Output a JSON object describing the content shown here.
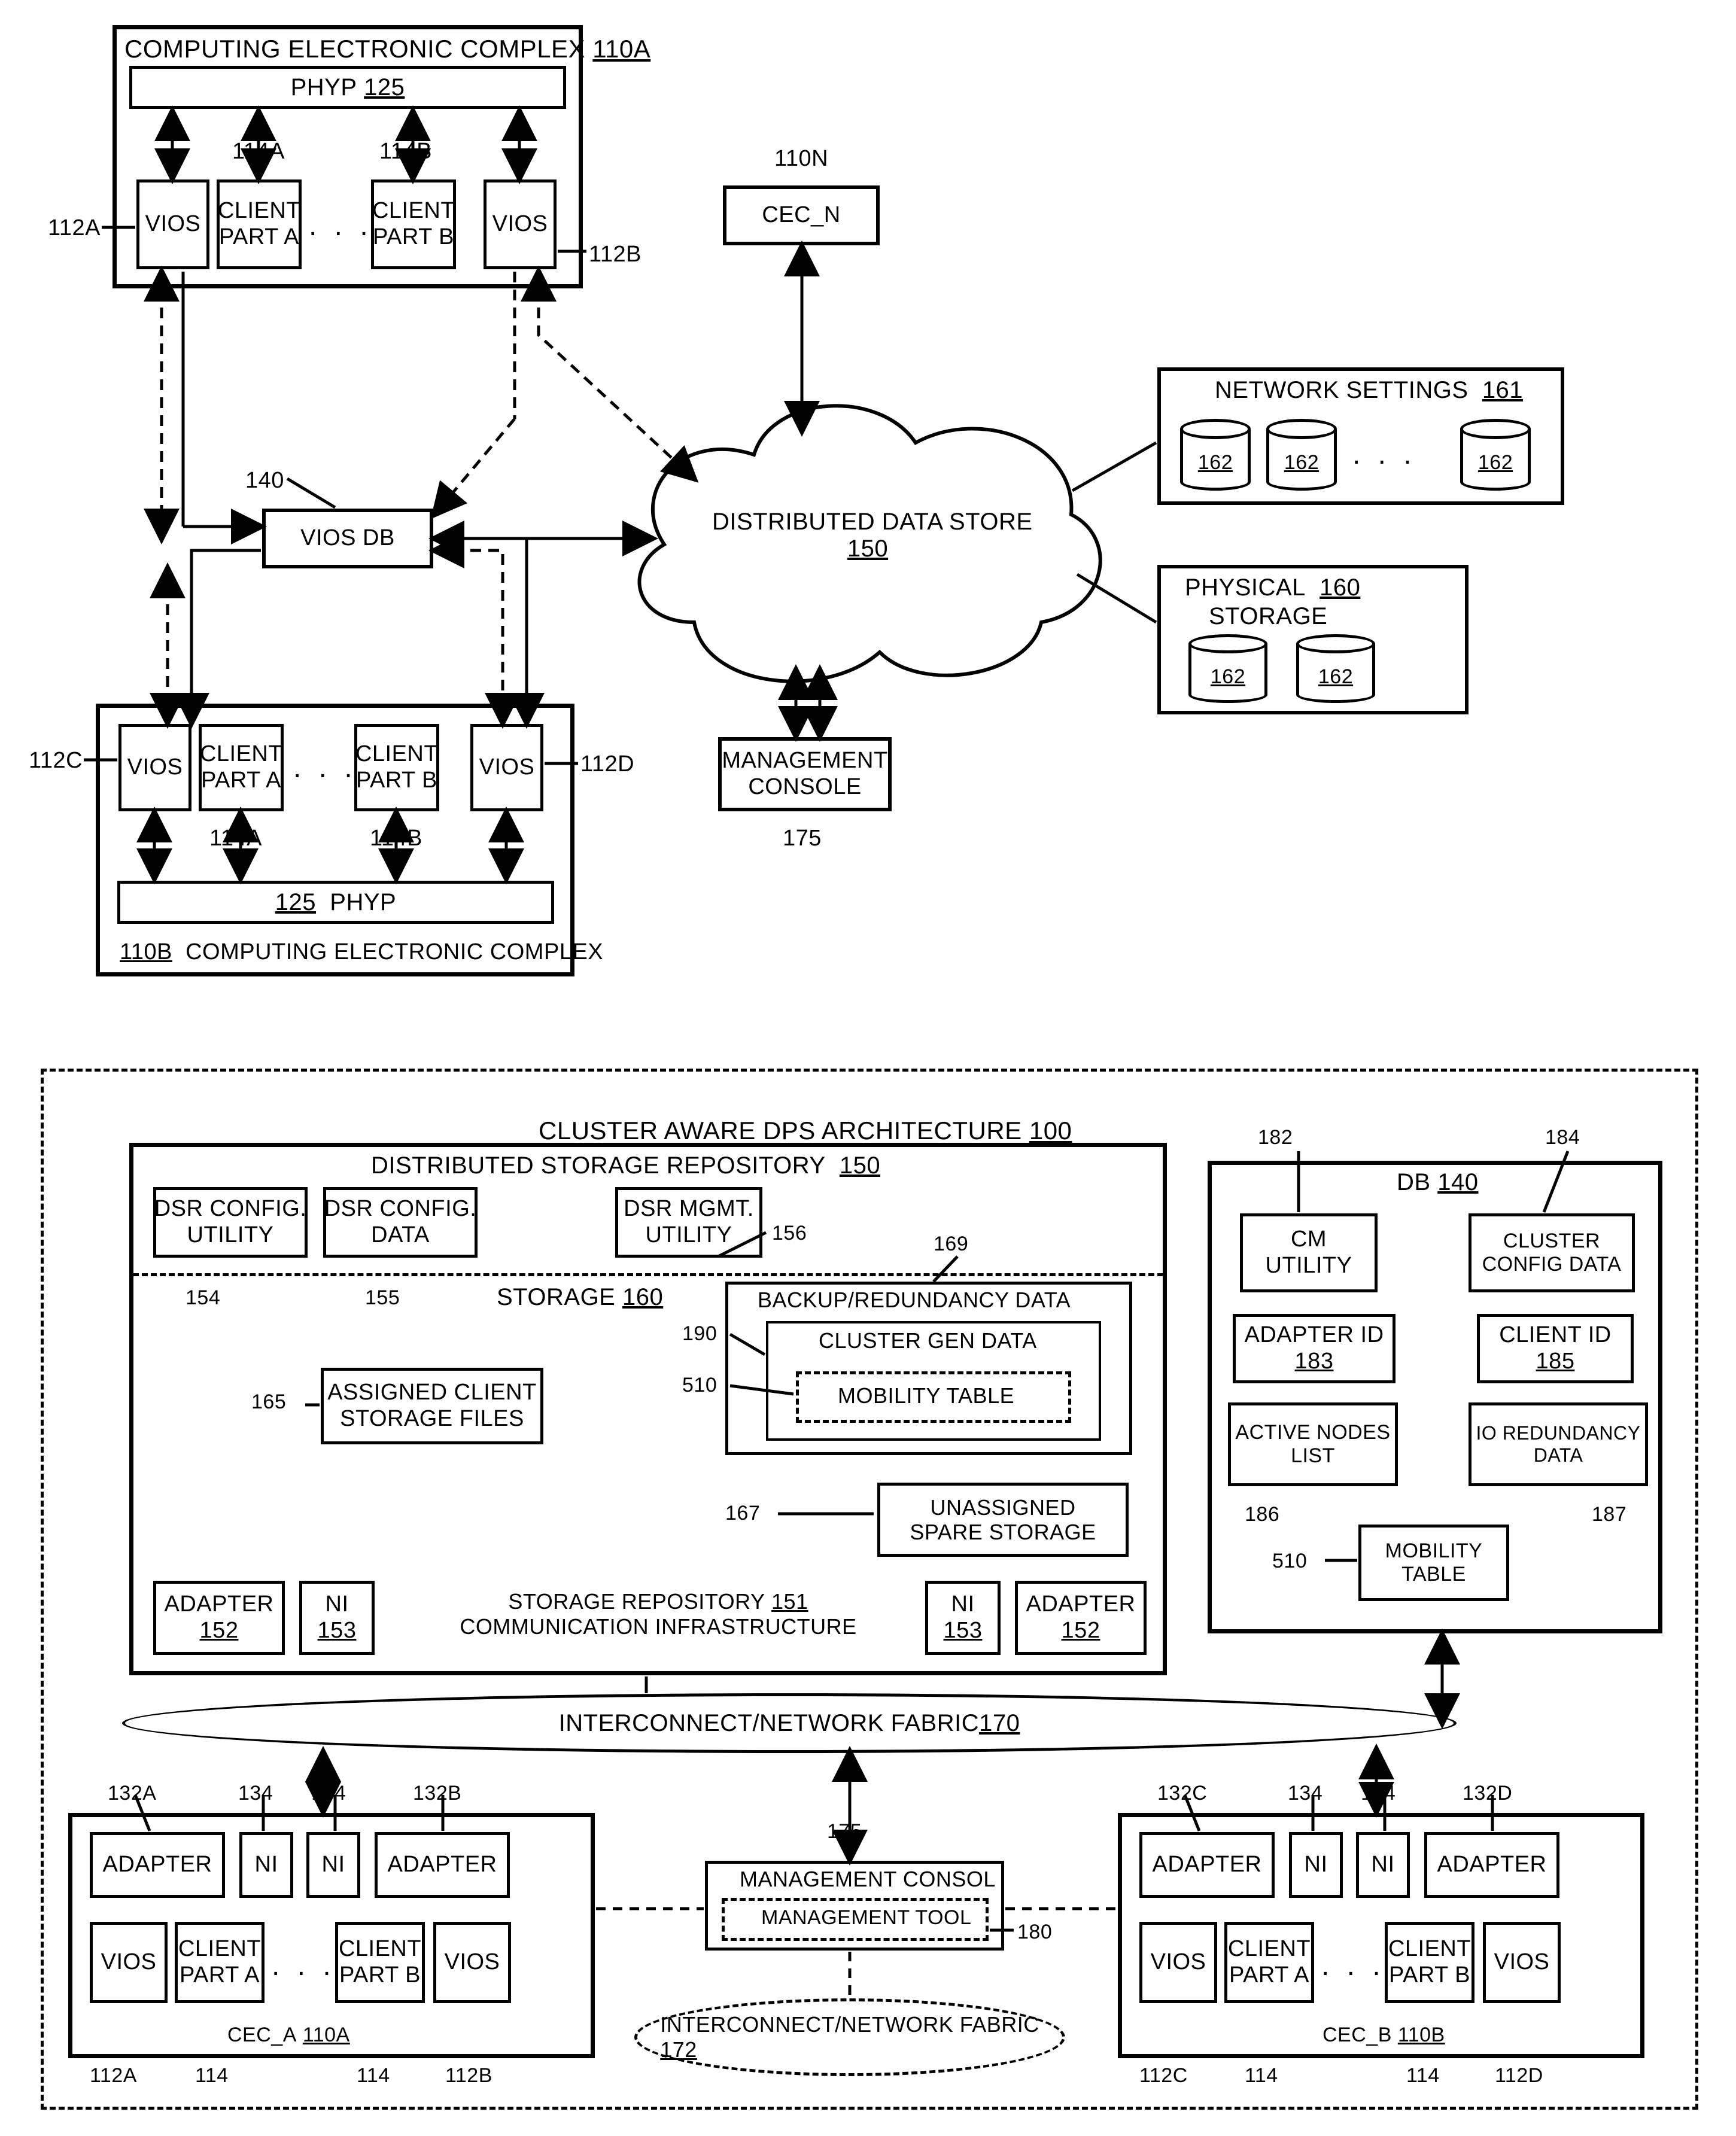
{
  "fig1": {
    "cec_a": {
      "title": "COMPUTING ELECTRONIC COMPLEX",
      "ref": "110A",
      "phyp": "PHYP",
      "phyp_ref": "125"
    },
    "cec_b": {
      "title": "COMPUTING ELECTRONIC COMPLEX",
      "ref": "110B",
      "phyp": "PHYP",
      "phyp_ref": "125"
    },
    "vios": "VIOS",
    "client_a": "CLIENT\nPART A",
    "client_b": "CLIENT\nPART B",
    "refs": {
      "v112a": "112A",
      "v112b": "112B",
      "v112c": "112C",
      "v112d": "112D",
      "c114a": "114A",
      "c114b": "114B",
      "n110n": "110N",
      "viosdb140": "140",
      "mc175": "175"
    },
    "cec_n": "CEC_N",
    "vios_db": "VIOS DB",
    "dds": {
      "l1": "DISTRIBUTED DATA STORE",
      "ref": "150"
    },
    "mgmt": "MANAGEMENT\nCONSOLE",
    "net_settings": {
      "title": "NETWORK SETTINGS",
      "ref": "161",
      "item": "162"
    },
    "phys_storage": {
      "title": "PHYSICAL",
      "title2": "STORAGE",
      "ref": "160",
      "item": "162"
    }
  },
  "fig2": {
    "arch": {
      "title": "CLUSTER AWARE DPS ARCHITECTURE",
      "ref": "100"
    },
    "dsr": {
      "title": "DISTRIBUTED STORAGE REPOSITORY",
      "ref": "150",
      "cfg_util": "DSR CONFIG.\nUTILITY",
      "cfg_util_ref": "154",
      "cfg_data": "DSR CONFIG.\nDATA",
      "cfg_data_ref": "155",
      "mgmt_util": "DSR MGMT.\nUTILITY",
      "mgmt_util_ref": "156",
      "storage": "STORAGE",
      "storage_ref": "160",
      "assigned": "ASSIGNED CLIENT\nSTORAGE FILES",
      "assigned_ref": "165",
      "backup": "BACKUP/REDUNDANCY DATA",
      "backup_ref": "169",
      "cgen": "CLUSTER GEN DATA",
      "cgen_ref": "190",
      "mob": "MOBILITY TABLE",
      "mob_ref": "510",
      "unassigned": "UNASSIGNED\nSPARE STORAGE",
      "unassigned_ref": "167",
      "sr": {
        "title": "STORAGE REPOSITORY",
        "ref": "151",
        "sub": "COMMUNICATION INFRASTRUCTURE",
        "adapter": "ADAPTER",
        "adapter_ref": "152",
        "ni": "NI",
        "ni_ref": "153"
      }
    },
    "db": {
      "title": "DB",
      "ref": "140",
      "cm": "CM\nUTILITY",
      "cm_ref": "182",
      "ccfg": "CLUSTER\nCONFIG DATA",
      "ccfg_ref": "184",
      "aid": "ADAPTER ID",
      "aid_ref": "183",
      "cid": "CLIENT ID",
      "cid_ref": "185",
      "anl": "ACTIVE NODES\nLIST",
      "anl_ref": "186",
      "iord": "IO REDUNDANCY\nDATA",
      "iord_ref": "187",
      "mob": "MOBILITY\nTABLE",
      "mob_ref": "510"
    },
    "fabric": {
      "title": "INTERCONNECT/NETWORK FABRIC",
      "ref": "170"
    },
    "fabric2": {
      "title": "INTERCONNECT/NETWORK FABRIC",
      "ref": "172"
    },
    "cec_a": {
      "title": "CEC_A",
      "ref": "110A"
    },
    "cec_b": {
      "title": "CEC_B",
      "ref": "110B"
    },
    "adapter": "ADAPTER",
    "ni": "NI",
    "vios": "VIOS",
    "client_a": "CLIENT\nPART A",
    "client_b": "CLIENT\nPART B",
    "mc": {
      "title": "MANAGEMENT CONSOL",
      "tool": "MANAGEMENT TOOL",
      "ref": "175",
      "tool_ref": "180"
    },
    "refs": {
      "a132a": "132A",
      "a132b": "132B",
      "a132c": "132C",
      "a132d": "132D",
      "ni134": "134",
      "v112a": "112A",
      "v112b": "112B",
      "v112c": "112C",
      "v112d": "112D",
      "c114": "114"
    }
  },
  "misc": {
    "dots": ". . ."
  }
}
